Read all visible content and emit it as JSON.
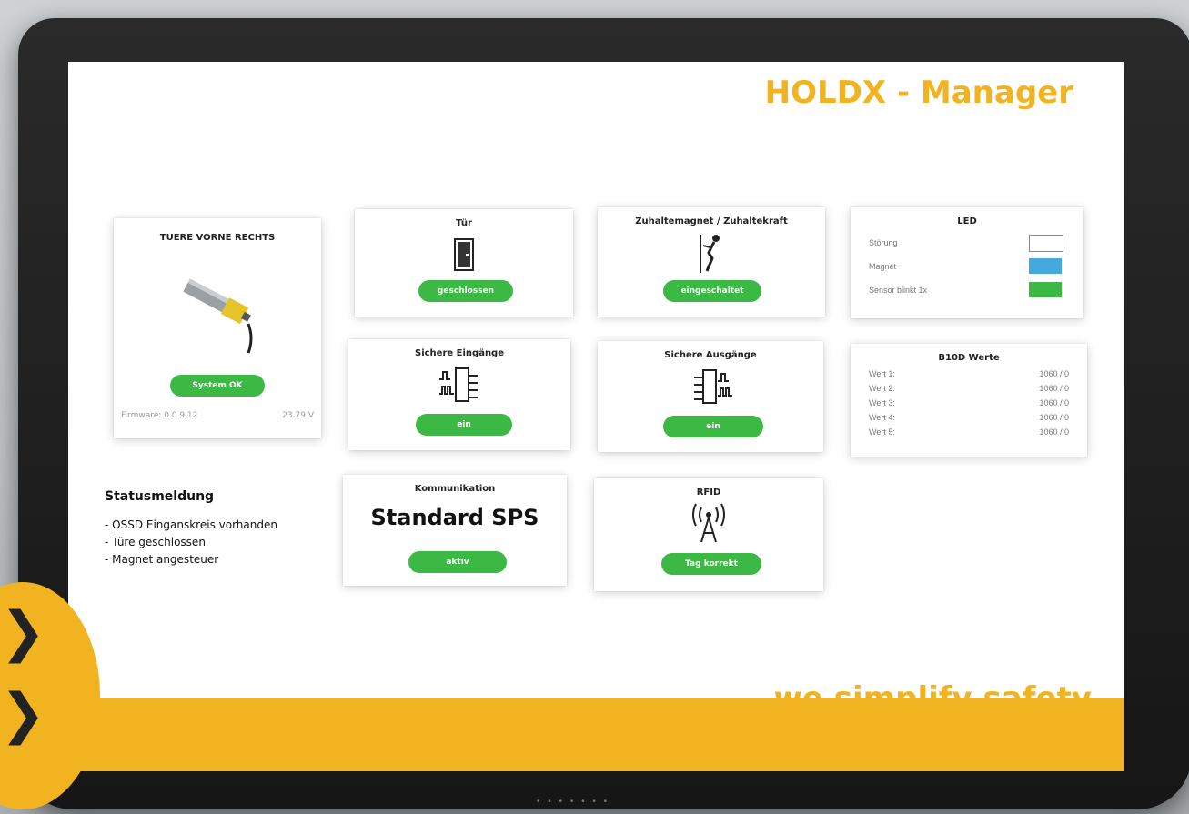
{
  "app": {
    "title": "HOLDX - Manager",
    "slogan": "we simplify safety"
  },
  "device": {
    "name": "TUERE VORNE RECHTS",
    "status_button": "System OK",
    "firmware": "Firmware: 0.0.9.12",
    "voltage": "23.79 V"
  },
  "tuer": {
    "title": "Tür",
    "button": "geschlossen"
  },
  "zuhaltemagnet": {
    "title": "Zuhaltemagnet / Zuhaltekraft",
    "button": "eingeschaltet"
  },
  "led": {
    "title": "LED",
    "rows": [
      {
        "label": "Störung",
        "color": "#ffffff"
      },
      {
        "label": "Magnet",
        "color": "#45a9e0"
      },
      {
        "label": "Sensor blinkt 1x",
        "color": "#3cb944"
      }
    ]
  },
  "eingaenge": {
    "title": "Sichere Eingänge",
    "button": "ein"
  },
  "ausgaenge": {
    "title": "Sichere Ausgänge",
    "button": "ein"
  },
  "b10d": {
    "title": "B10D Werte",
    "rows": [
      {
        "label": "Wert 1:",
        "value": "1060 / 0"
      },
      {
        "label": "Wert 2:",
        "value": "1060 / 0"
      },
      {
        "label": "Wert 3:",
        "value": "1060 / 0"
      },
      {
        "label": "Wert 4:",
        "value": "1060 / 0"
      },
      {
        "label": "Wert 5:",
        "value": "1060 / 0"
      }
    ]
  },
  "statusmeldung": {
    "title": "Statusmeldung",
    "lines": [
      "- OSSD Einganskreis vorhanden",
      "- Türe geschlossen",
      "- Magnet angesteuer"
    ]
  },
  "kommunikation": {
    "title": "Kommunikation",
    "value": "Standard SPS",
    "button": "aktiv"
  },
  "rfid": {
    "title": "RFID",
    "button": "Tag korrekt"
  },
  "colors": {
    "accent": "#f2b320",
    "ok_green": "#3cb944"
  },
  "bezel": {
    "speaker": "• • • • • • •"
  }
}
